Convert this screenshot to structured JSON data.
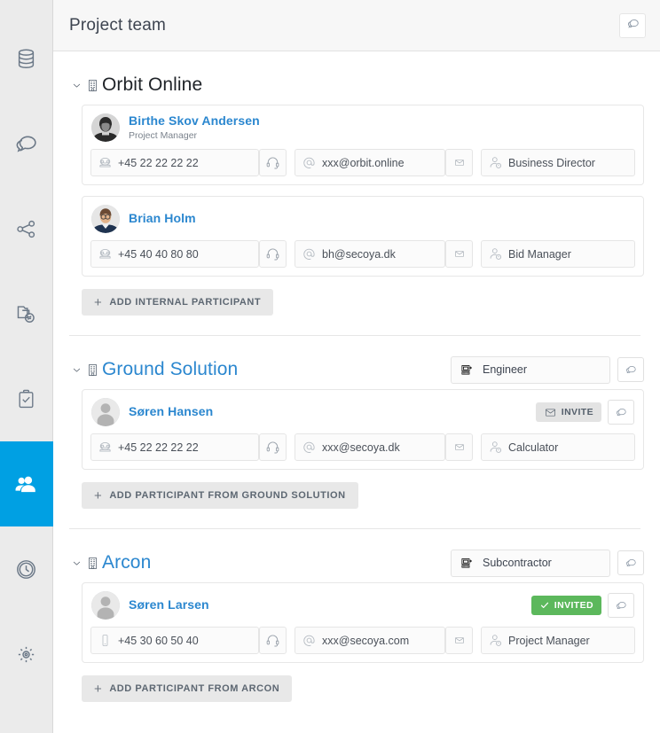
{
  "rail": {
    "items": [
      {
        "name": "database-icon",
        "label": "Data",
        "active": false
      },
      {
        "name": "chat-icon",
        "label": "Chat",
        "active": false
      },
      {
        "name": "share-nodes-icon",
        "label": "Share",
        "active": false
      },
      {
        "name": "document-transfer-icon",
        "label": "Documents",
        "active": false
      },
      {
        "name": "clipboard-check-icon",
        "label": "Tasks",
        "active": false
      },
      {
        "name": "people-icon",
        "label": "Project team",
        "active": true
      },
      {
        "name": "clock-icon",
        "label": "Time",
        "active": false
      },
      {
        "name": "gear-icon",
        "label": "Settings",
        "active": false
      }
    ]
  },
  "header": {
    "title": "Project team",
    "chat_button_label": "Chat"
  },
  "sections": [
    {
      "company": "Orbit Online",
      "title_blue": false,
      "company_type": null,
      "has_chat_button": false,
      "people": [
        {
          "name": "Birthe Skov Andersen",
          "subtitle": "Project Manager",
          "avatar": "photo-female",
          "badge": null,
          "has_chat_button": false,
          "phone_icon": "telephone-icon",
          "phone": "+45 22 22 22 22",
          "email": "xxx@orbit.online",
          "role": "Business Director"
        },
        {
          "name": "Brian Holm",
          "subtitle": null,
          "avatar": "photo-male",
          "badge": null,
          "has_chat_button": false,
          "phone_icon": "telephone-icon",
          "phone": "+45 40 40 80 80",
          "email": "bh@secoya.dk",
          "role": "Bid Manager"
        }
      ],
      "add_button": "ADD INTERNAL PARTICIPANT",
      "divider_after": true
    },
    {
      "company": "Ground Solution",
      "title_blue": true,
      "company_type": "Engineer",
      "has_chat_button": true,
      "people": [
        {
          "name": "Søren Hansen",
          "subtitle": null,
          "avatar": "placeholder",
          "badge": {
            "text": "INVITE",
            "style": "invite",
            "icon": "envelope-icon"
          },
          "has_chat_button": true,
          "phone_icon": "telephone-icon",
          "phone": "+45 22 22 22 22",
          "email": "xxx@secoya.dk",
          "role": "Calculator"
        }
      ],
      "add_button": "ADD PARTICIPANT FROM GROUND SOLUTION",
      "divider_after": true
    },
    {
      "company": "Arcon",
      "title_blue": true,
      "company_type": "Subcontractor",
      "has_chat_button": true,
      "people": [
        {
          "name": "Søren Larsen",
          "subtitle": null,
          "avatar": "placeholder",
          "badge": {
            "text": "INVITED",
            "style": "invited",
            "icon": "check-icon"
          },
          "has_chat_button": true,
          "phone_icon": "mobile-icon",
          "phone": "+45 30 60 50 40",
          "email": "xxx@secoya.com",
          "role": "Project Manager"
        }
      ],
      "add_button": "ADD PARTICIPANT FROM ARCON",
      "divider_after": false
    }
  ],
  "colors": {
    "accent": "#00a0e3",
    "link": "#2b87cf",
    "success": "#5cb85c",
    "rail_bg": "#ebebeb",
    "topbar_bg": "#f7f7f7"
  }
}
